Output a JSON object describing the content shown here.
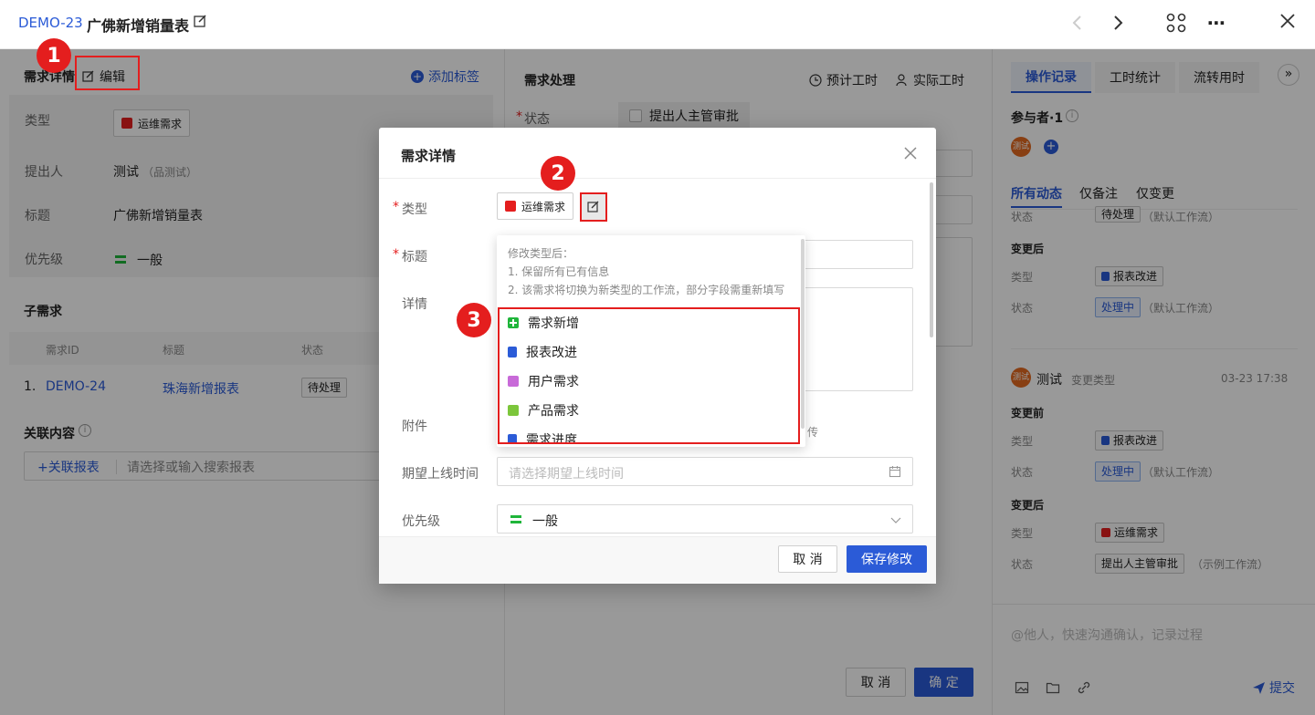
{
  "header": {
    "issue_id": "DEMO-23",
    "title": "广佛新增销量表"
  },
  "left": {
    "section_title": "需求详情",
    "edit_label": "编辑",
    "add_tag_label": "添加标签",
    "fields": {
      "type_label": "类型",
      "type_value": "运维需求",
      "proposer_label": "提出人",
      "proposer_value": "测试",
      "proposer_sub": "（品测试）",
      "title_label": "标题",
      "title_value": "广佛新增销量表",
      "priority_label": "优先级",
      "priority_value": "一般"
    },
    "sub_title": "子需求",
    "sub_headers": [
      "需求ID",
      "标题",
      "状态"
    ],
    "sub_rows": [
      {
        "num": "1.",
        "id": "DEMO-24",
        "title": "珠海新增报表",
        "status": "待处理"
      }
    ],
    "related_title": "关联内容",
    "related_button": "+关联报表",
    "related_placeholder": "请选择或输入搜索报表"
  },
  "middle": {
    "title": "需求处理",
    "planned_hours": "预计工时",
    "actual_hours": "实际工时",
    "status_label": "状态",
    "status_value": "提出人主管审批",
    "cancel": "取 消",
    "confirm": "确 定"
  },
  "right": {
    "tabs": [
      "操作记录",
      "工时统计",
      "流转用时"
    ],
    "participants": "参与者·1",
    "avatar_text": "测试",
    "filters": [
      "所有动态",
      "仅备注",
      "仅变更"
    ],
    "log_top": {
      "status_label": "状态",
      "status_value": "待处理",
      "status_note": "（默认工作流）"
    },
    "log1": {
      "after_label": "变更后",
      "type_label": "类型",
      "type_value": "报表改进",
      "status_label": "状态",
      "status_value": "处理中",
      "status_note": "（默认工作流）"
    },
    "log2": {
      "user": "测试",
      "action": "变更类型",
      "time": "03-23 17:38",
      "before_label": "变更前",
      "b_type_label": "类型",
      "b_type_value": "报表改进",
      "b_status_label": "状态",
      "b_status_value": "处理中",
      "b_status_note": "（默认工作流）",
      "after_label": "变更后",
      "a_type_label": "类型",
      "a_type_value": "运维需求",
      "a_status_label": "状态",
      "a_status_value": "提出人主管审批",
      "a_status_note": "（示例工作流）"
    },
    "comment_placeholder": "@他人，快速沟通确认，记录过程",
    "submit": "提交"
  },
  "modal": {
    "title": "需求详情",
    "type_label": "类型",
    "type_value": "运维需求",
    "title_label": "标题",
    "detail_label": "详情",
    "attachment_label": "附件",
    "upload_tail": "传",
    "date_label": "期望上线时间",
    "date_placeholder": "请选择期望上线时间",
    "priority_label": "优先级",
    "priority_value": "一般",
    "cancel": "取 消",
    "save": "保存修改",
    "dropdown": {
      "hint_title": "修改类型后：",
      "hint_1": "1. 保留所有已有信息",
      "hint_2": "2. 该需求将切换为新类型的工作流，部分字段需重新填写",
      "options": [
        {
          "label": "需求新增",
          "color": "#1fb53a"
        },
        {
          "label": "报表改进",
          "color": "#2b5bd7"
        },
        {
          "label": "用户需求",
          "color": "#c86ad8"
        },
        {
          "label": "产品需求",
          "color": "#7cc63b"
        },
        {
          "label": "需求进度",
          "color": "#2b5bd7"
        }
      ]
    }
  },
  "annotations": {
    "badge1": "1",
    "badge2": "2",
    "badge3": "3"
  }
}
